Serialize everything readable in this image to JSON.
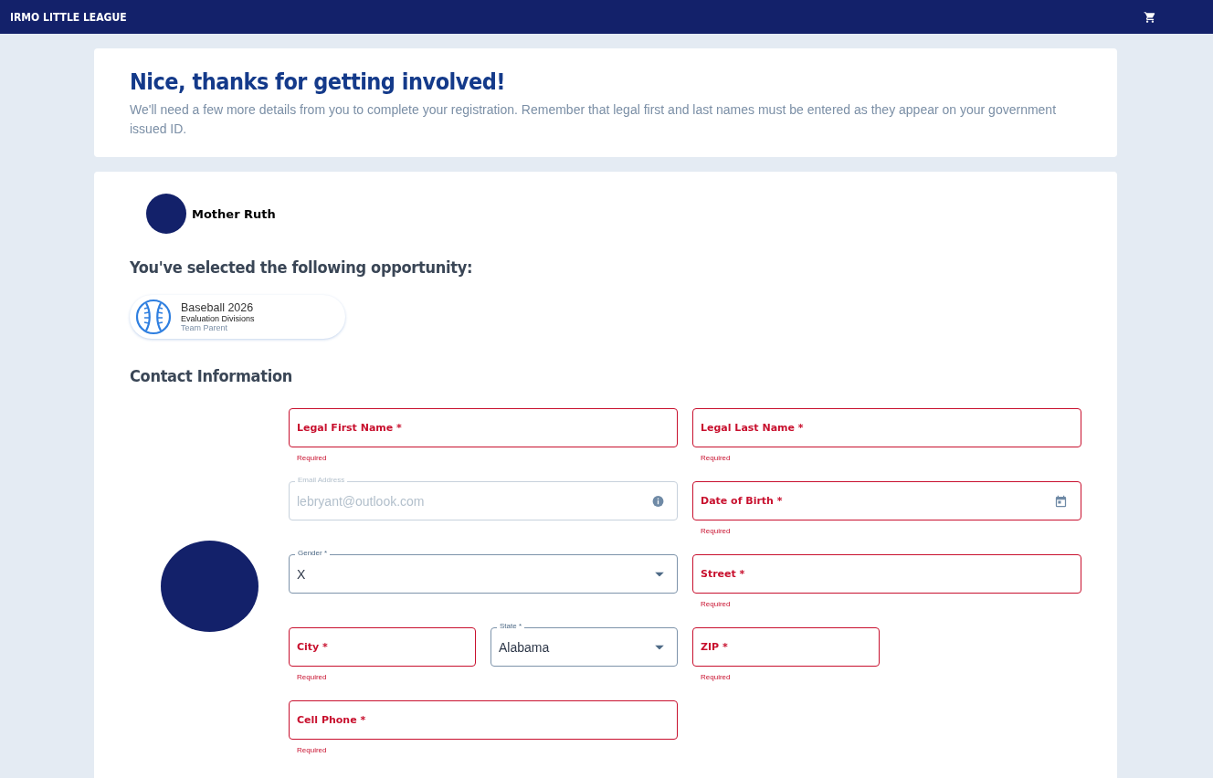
{
  "topbar": {
    "brand": "IRMO LITTLE LEAGUE"
  },
  "intro": {
    "title": "Nice, thanks for getting involved!",
    "text": "We'll need a few more details from you to complete your registration. Remember that legal first and last names must be entered as they appear on your government issued ID."
  },
  "person": {
    "name": "Mother Ruth"
  },
  "opportunity": {
    "heading": "You've selected the following opportunity:",
    "title": "Baseball 2026",
    "division": "Evaluation Divisions",
    "role": "Team Parent"
  },
  "contact": {
    "heading": "Contact Information",
    "rows": [
      [
        {
          "kind": "text",
          "label": "Legal First Name *",
          "error": "Required"
        },
        {
          "kind": "text",
          "label": "Legal Last Name *",
          "error": "Required"
        }
      ],
      [
        {
          "kind": "email",
          "label": "Email Address",
          "value": "lebryant@outlook.com",
          "disabled": true
        },
        {
          "kind": "date",
          "label": "Date of Birth *",
          "error": "Required"
        }
      ],
      [
        {
          "kind": "select",
          "label": "Gender *",
          "value": "X"
        },
        {
          "kind": "text",
          "label": "Street *",
          "error": "Required"
        }
      ],
      [
        {
          "kind": "text",
          "label": "City *",
          "error": "Required"
        },
        {
          "kind": "select",
          "label": "State *",
          "value": "Alabama"
        },
        {
          "kind": "text",
          "label": "ZIP *",
          "error": "Required"
        }
      ],
      [
        {
          "kind": "text",
          "label": "Cell Phone *",
          "error": "Required"
        }
      ]
    ]
  }
}
